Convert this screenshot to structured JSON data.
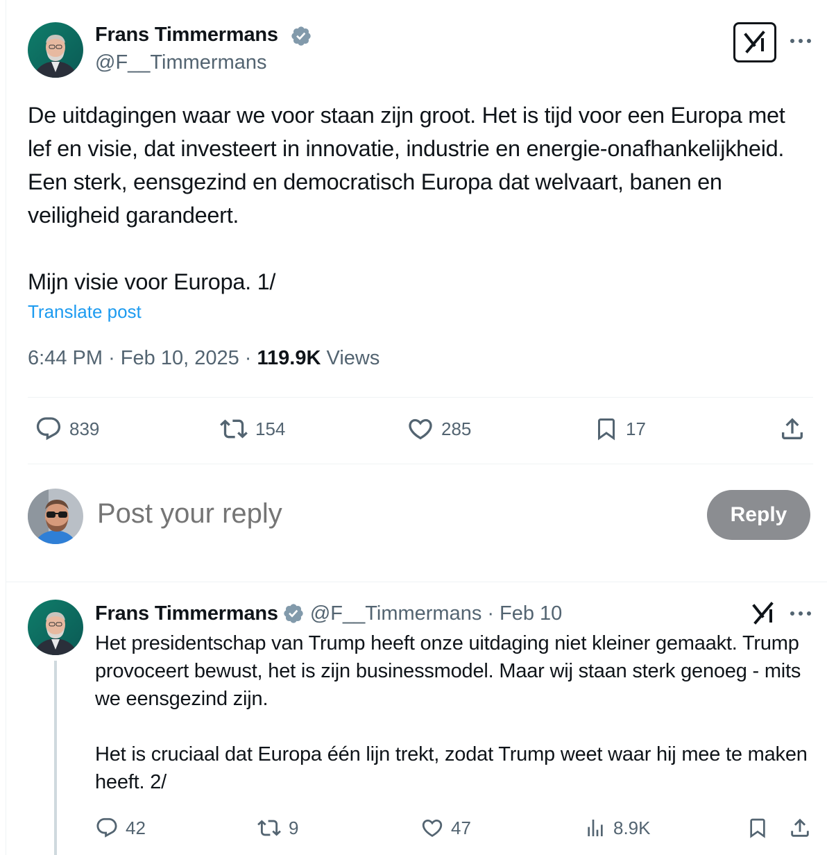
{
  "main_post": {
    "author_name": "Frans Timmermans",
    "author_handle": "@F__Timmermans",
    "text": "De uitdagingen waar we voor staan zijn groot. Het is tijd voor een Europa met lef en visie, dat investeert in innovatie, industrie en energie-onafhankelijkheid. Een sterk, eensgezind en democratisch Europa dat welvaart, banen en veiligheid garandeert.\n\nMijn visie voor Europa. 1/",
    "translate_label": "Translate post",
    "time": "6:44 PM",
    "date": "Feb 10, 2025",
    "separator": "·",
    "views_count": "119.9K",
    "views_label": "Views",
    "stats": {
      "replies": "839",
      "reposts": "154",
      "likes": "285",
      "bookmarks": "17"
    }
  },
  "composer": {
    "placeholder": "Post your reply",
    "reply_button": "Reply"
  },
  "thread_post": {
    "author_name": "Frans Timmermans",
    "author_handle": "@F__Timmermans",
    "separator": "·",
    "date": "Feb 10",
    "text": "Het presidentschap van Trump heeft onze uitdaging niet kleiner gemaakt. Trump provoceert bewust, het is zijn businessmodel. Maar wij staan sterk genoeg - mits we eensgezind zijn.\n\nHet is cruciaal dat Europa één lijn trekt, zodat Trump weet waar hij mee te maken heeft. 2/",
    "stats": {
      "replies": "42",
      "reposts": "9",
      "likes": "47",
      "views": "8.9K"
    }
  },
  "colors": {
    "text_primary": "#0f1419",
    "text_secondary": "#536471",
    "link": "#1d9bf0",
    "verified_badge": "#829aab",
    "reply_button_bg": "#8b8d91",
    "divider": "#eff3f4",
    "thread_line": "#cfd9de"
  },
  "icons": {
    "verified": "verified-badge-icon",
    "grok": "grok-icon",
    "more": "more-icon",
    "reply": "reply-icon",
    "repost": "repost-icon",
    "like": "like-icon",
    "bookmark": "bookmark-icon",
    "share": "share-icon",
    "views": "views-icon"
  }
}
